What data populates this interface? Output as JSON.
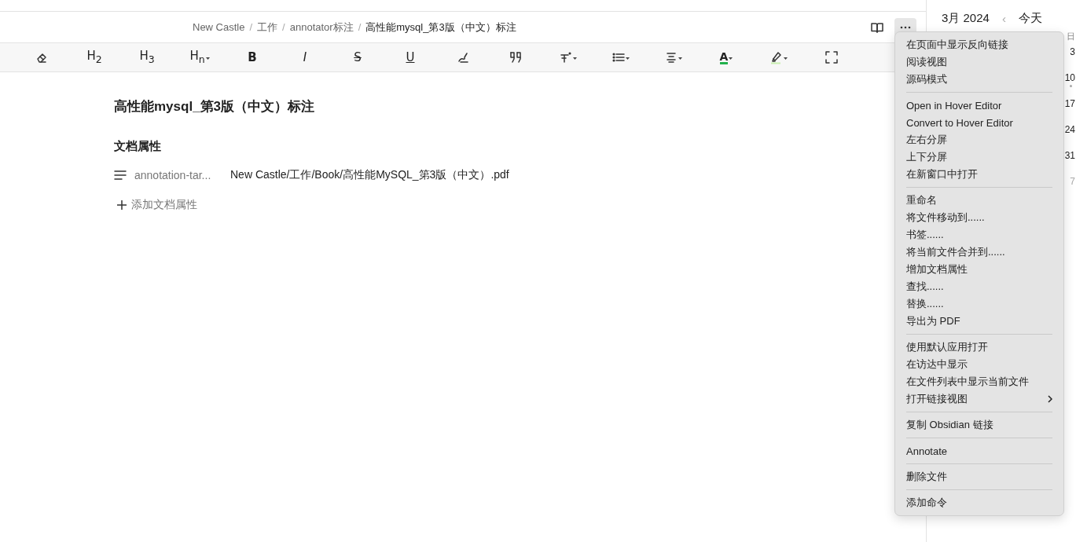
{
  "breadcrumb": [
    "New Castle",
    "工作",
    "annotator标注",
    "高性能mysql_第3版（中文）标注"
  ],
  "breadcrumb_separator": "/",
  "header_buttons": [
    {
      "kind": "book",
      "selected": false
    },
    {
      "kind": "more",
      "selected": true
    }
  ],
  "toolbar": [
    {
      "kind": "eraser"
    },
    {
      "kind": "heading",
      "label": "H$_{2}$",
      "dropdown": false
    },
    {
      "kind": "heading",
      "label": "H$_{3}$",
      "dropdown": false
    },
    {
      "kind": "heading",
      "label": "H$_{n}$",
      "dropdown": true
    },
    {
      "kind": "bold",
      "label": "B",
      "dropdown": false
    },
    {
      "kind": "italic",
      "label": "I",
      "dropdown": false
    },
    {
      "kind": "strike",
      "label": "S",
      "dropdown": false
    },
    {
      "kind": "underline",
      "label": "U",
      "dropdown": false
    },
    {
      "kind": "brush"
    },
    {
      "kind": "quote"
    },
    {
      "kind": "clear-format",
      "dropdown": true
    },
    {
      "kind": "list",
      "dropdown": true
    },
    {
      "kind": "align",
      "dropdown": true
    },
    {
      "kind": "text-color",
      "label": "A",
      "color": "#22b14c",
      "dropdown": true
    },
    {
      "kind": "highlighter",
      "color": "#c9f0b0",
      "dropdown": true
    },
    {
      "kind": "fullscreen"
    }
  ],
  "note": {
    "title": "高性能mysql_第3版（中文）标注",
    "properties_heading": "文档属性",
    "properties": [
      {
        "key": "annotation-tar...",
        "value": "New Castle/工作/Book/高性能MySQL_第3版（中文）.pdf"
      }
    ],
    "add_property": "添加文档属性"
  },
  "calendar": {
    "month": "3月 2024",
    "previous": "‹",
    "today": "今天",
    "weekday": "日",
    "days": [
      {
        "label": "3",
        "muted": false,
        "dot": false
      },
      {
        "label": "10",
        "muted": false,
        "dot": true
      },
      {
        "label": "17",
        "muted": false,
        "dot": false
      },
      {
        "label": "24",
        "muted": false,
        "dot": false
      },
      {
        "label": "31",
        "muted": false,
        "dot": false
      },
      {
        "label": "7",
        "muted": true,
        "dot": false
      }
    ]
  },
  "menu": {
    "sections": [
      {
        "items": [
          {
            "label": "在页面中显示反向链接",
            "submenu": false
          },
          {
            "label": "阅读视图",
            "submenu": false
          },
          {
            "label": "源码模式",
            "submenu": false
          }
        ]
      },
      {
        "items": [
          {
            "label": "Open in Hover Editor",
            "submenu": false
          },
          {
            "label": "Convert to Hover Editor",
            "submenu": false
          },
          {
            "label": "左右分屏",
            "submenu": false
          },
          {
            "label": "上下分屏",
            "submenu": false
          },
          {
            "label": "在新窗口中打开",
            "submenu": false
          }
        ]
      },
      {
        "items": [
          {
            "label": "重命名",
            "submenu": false
          },
          {
            "label": "将文件移动到......",
            "submenu": false
          },
          {
            "label": "书签......",
            "submenu": false
          },
          {
            "label": "将当前文件合并到......",
            "submenu": false
          },
          {
            "label": "增加文档属性",
            "submenu": false
          },
          {
            "label": "查找......",
            "submenu": false
          },
          {
            "label": "替换......",
            "submenu": false
          },
          {
            "label": "导出为 PDF",
            "submenu": false
          }
        ]
      },
      {
        "items": [
          {
            "label": "使用默认应用打开",
            "submenu": false
          },
          {
            "label": "在访达中显示",
            "submenu": false
          },
          {
            "label": "在文件列表中显示当前文件",
            "submenu": false
          },
          {
            "label": "打开链接视图",
            "submenu": true
          }
        ]
      },
      {
        "items": [
          {
            "label": "复制 Obsidian 链接",
            "submenu": false
          }
        ]
      },
      {
        "items": [
          {
            "label": "Annotate",
            "submenu": false
          }
        ]
      },
      {
        "items": [
          {
            "label": "删除文件",
            "submenu": false
          }
        ]
      },
      {
        "items": [
          {
            "label": "添加命令",
            "submenu": false
          }
        ]
      }
    ]
  }
}
